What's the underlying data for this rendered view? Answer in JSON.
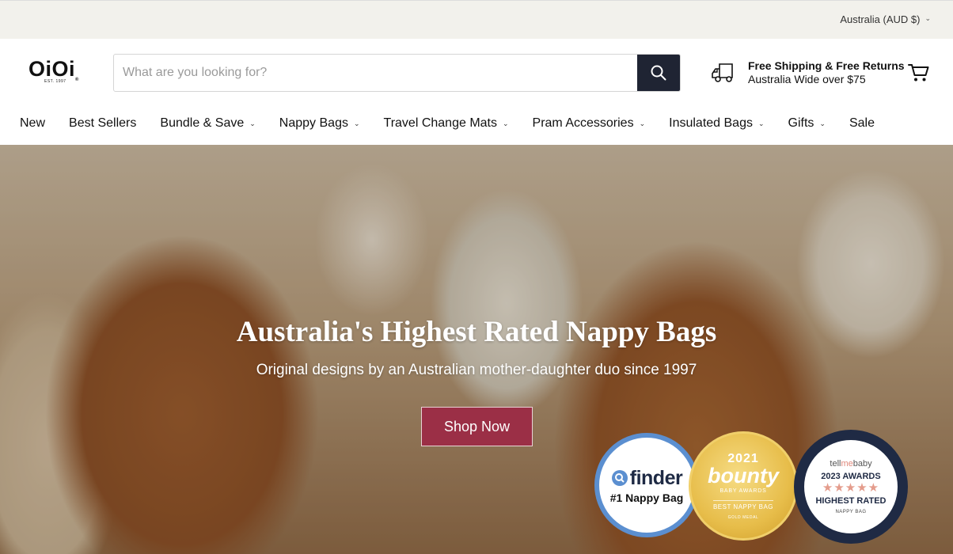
{
  "topbar": {
    "region": "Australia (AUD $)"
  },
  "header": {
    "logo": "OiOi",
    "logo_mark": "®",
    "logo_est": "EST. 1997",
    "search_placeholder": "What are you looking for?",
    "shipping_title": "Free Shipping & Free Returns",
    "shipping_sub": "Australia Wide over $75"
  },
  "nav": {
    "items": [
      {
        "label": "New",
        "caret": false
      },
      {
        "label": "Best Sellers",
        "caret": false
      },
      {
        "label": "Bundle & Save",
        "caret": true
      },
      {
        "label": "Nappy Bags",
        "caret": true
      },
      {
        "label": "Travel Change Mats",
        "caret": true
      },
      {
        "label": "Pram Accessories",
        "caret": true
      },
      {
        "label": "Insulated Bags",
        "caret": true
      },
      {
        "label": "Gifts",
        "caret": true
      },
      {
        "label": "Sale",
        "caret": false
      }
    ]
  },
  "hero": {
    "title": "Australia's Highest Rated Nappy Bags",
    "subtitle": "Original designs by an Australian mother-daughter duo since 1997",
    "cta": "Shop Now"
  },
  "badges": {
    "finder": {
      "brand": "finder",
      "text": "#1 Nappy Bag"
    },
    "bounty": {
      "year": "2021",
      "brand": "bounty",
      "line1": "BABY AWARDS",
      "line2": "BEST NAPPY BAG",
      "line3": "GOLD MEDAL"
    },
    "tellmebaby": {
      "brand_a": "tell",
      "brand_b": "me",
      "brand_c": "baby",
      "line1": "2023 AWARDS",
      "stars": "★★★★★",
      "line2": "HIGHEST RATED",
      "line3": "NAPPY BAG"
    }
  },
  "colors": {
    "topbar": "#f2f1ec",
    "search_button": "#1f2433",
    "cta": "#9b2f46",
    "finder_ring": "#5b8fd0",
    "bounty_gold": "#e7bd4a",
    "tellmebaby_navy": "#1f2a44"
  }
}
